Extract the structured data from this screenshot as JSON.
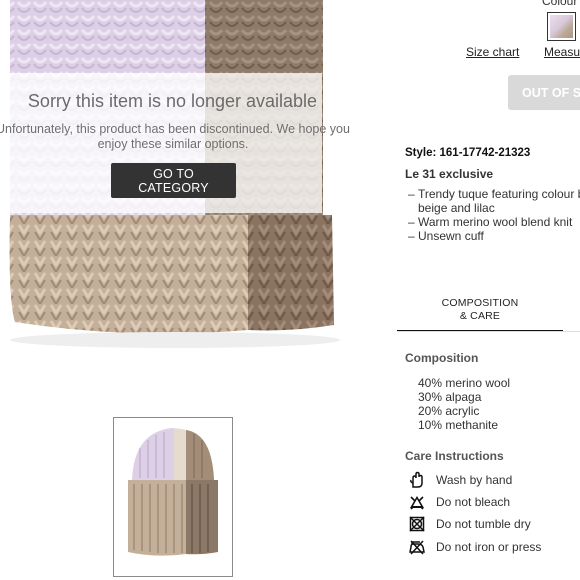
{
  "overlay": {
    "title": "Sorry this item is no longer available",
    "message": "Unfortunately, this product has been discontinued. We hope you enjoy these similar options.",
    "button_label": "GO TO CATEGORY"
  },
  "product_options": {
    "colour_label": "Colour",
    "size_chart_label": "Size chart",
    "measure_label": "Measur",
    "out_of_stock_label": "OUT OF STO"
  },
  "product": {
    "style": "Style: 161-17742-21323",
    "exclusive": "Le 31 exclusive",
    "features": [
      "Trendy tuque featuring colour bl beige and lilac",
      "Warm merino wool blend knit",
      "Unsewn cuff"
    ]
  },
  "tabs": {
    "composition_care": "COMPOSITION & CARE"
  },
  "composition": {
    "heading": "Composition",
    "items": [
      "40% merino wool",
      "30% alpaga",
      "20% acrylic",
      "10% methanite"
    ]
  },
  "care": {
    "heading": "Care Instructions",
    "items": [
      {
        "icon": "hand-wash-icon",
        "label": "Wash by hand"
      },
      {
        "icon": "no-bleach-icon",
        "label": "Do not bleach"
      },
      {
        "icon": "no-tumble-dry-icon",
        "label": "Do not tumble dry"
      },
      {
        "icon": "no-iron-icon",
        "label": "Do not iron or press"
      }
    ]
  },
  "colors": {
    "lilac": "#ddd0e6",
    "beige": "#cdbba6",
    "brown": "#8b7866",
    "button_dark": "#333333",
    "out_of_stock_bg": "#d9d9d9"
  }
}
